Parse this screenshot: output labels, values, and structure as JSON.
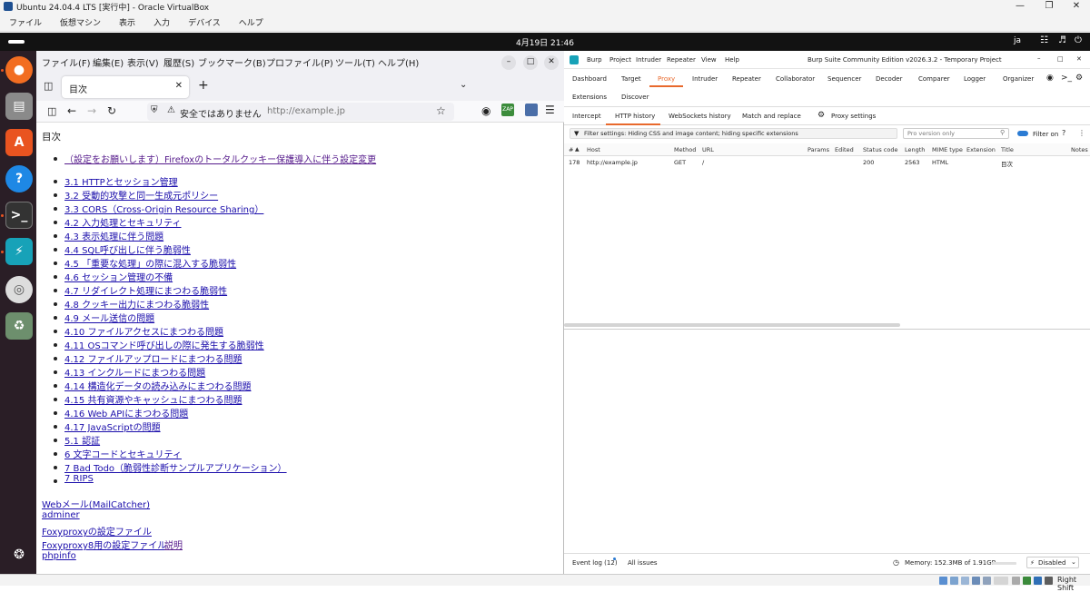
{
  "vbox": {
    "title": "Ubuntu 24.04.4 LTS [実行中] - Oracle VirtualBox",
    "menu": [
      "ファイル",
      "仮想マシン",
      "表示",
      "入力",
      "デバイス",
      "ヘルプ"
    ],
    "status_right": "Right Shift"
  },
  "ubuntu": {
    "clock": "4月19日 21:46",
    "lang": "ja"
  },
  "firefox": {
    "menu": [
      "ファイル(F)",
      "編集(E)",
      "表示(V)",
      "履歴(S)",
      "ブックマーク(B)",
      "プロファイル(P)",
      "ツール(T)",
      "ヘルプ(H)"
    ],
    "tab_title": "目次",
    "url_security": "安全ではありません",
    "url": "http://example.jp",
    "page": {
      "heading": "目次",
      "top_link": "（設定をお願いします）Firefoxのトータルクッキー保護導入に伴う設定変更",
      "toc": [
        "3.1 HTTPとセッション管理",
        "3.2 受動的攻撃と同一生成元ポリシー",
        "3.3 CORS（Cross-Origin Resource Sharing）",
        "4.2 入力処理とセキュリティ",
        "4.3 表示処理に伴う問題",
        "4.4 SQL呼び出しに伴う脆弱性",
        "4.5 「重要な処理」の際に混入する脆弱性",
        "4.6 セッション管理の不備",
        "4.7 リダイレクト処理にまつわる脆弱性",
        "4.8 クッキー出力にまつわる脆弱性",
        "4.9 メール送信の問題",
        "4.10 ファイルアクセスにまつわる問題",
        "4.11 OSコマンド呼び出しの際に発生する脆弱性",
        "4.12 ファイルアップロードにまつわる問題",
        "4.13 インクルードにまつわる問題",
        "4.14 構造化データの読み込みにまつわる問題",
        "4.15 共有資源やキャッシュにまつわる問題",
        "4.16 Web APIにまつわる問題",
        "4.17 JavaScriptの問題",
        "5.1 認証",
        "6 文字コードとセキュリティ",
        "7 Bad Todo（脆弱性診断サンプルアプリケーション）",
        "7 RIPS"
      ],
      "footer_links": [
        "Webメール(MailCatcher)",
        "adminer",
        "Foxyproxyの設定ファイル",
        "Foxyproxy8用の設定ファイル",
        "phpinfo"
      ],
      "footer_extra": "説明"
    }
  },
  "burp": {
    "menu": [
      "Burp",
      "Project",
      "Intruder",
      "Repeater",
      "View",
      "Help"
    ],
    "title": "Burp Suite Community Edition v2026.3.2 - Temporary Project",
    "tabs_row1": [
      "Dashboard",
      "Target",
      "Proxy",
      "Intruder",
      "Repeater",
      "Collaborator",
      "Sequencer",
      "Decoder",
      "Comparer",
      "Logger",
      "Organizer"
    ],
    "tabs_row1b": [
      "Extensions",
      "Discover"
    ],
    "active_tab": "Proxy",
    "subtabs": [
      "Intercept",
      "HTTP history",
      "WebSockets history",
      "Match and replace"
    ],
    "proxy_settings": "Proxy settings",
    "active_subtab": "HTTP history",
    "filter": "Filter settings: Hiding CSS and image content; hiding specific extensions",
    "search_placeholder": "Pro version only",
    "filter_on": "Filter on",
    "columns": [
      "#",
      "Host",
      "Method",
      "URL",
      "Params",
      "Edited",
      "Status code",
      "Length",
      "MIME type",
      "Extension",
      "Title",
      "Notes"
    ],
    "rows": [
      {
        "num": "178",
        "host": "http://example.jp",
        "method": "GET",
        "url": "/",
        "status": "200",
        "length": "2563",
        "mime": "HTML",
        "title": "目次"
      }
    ],
    "event_log": "Event log (12)",
    "all_issues": "All issues",
    "memory": "Memory: 152.3MB of 1.91GB",
    "disabled": "Disabled",
    "accent": "#e8692c"
  }
}
